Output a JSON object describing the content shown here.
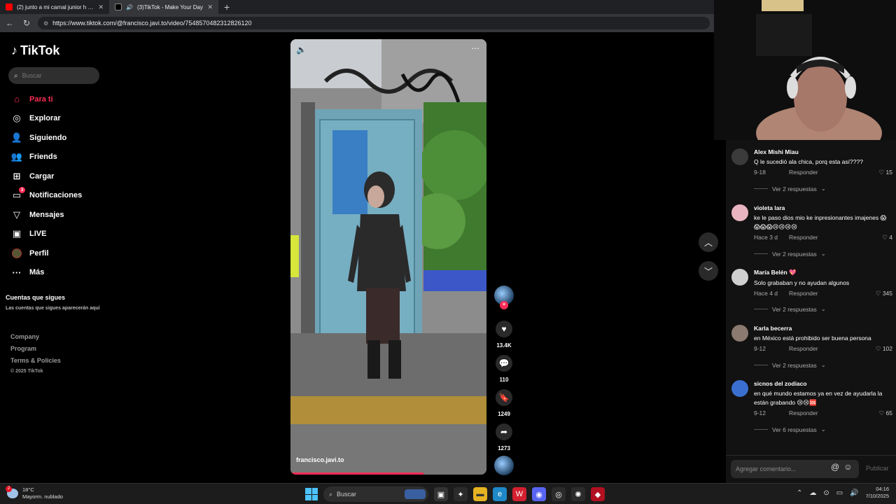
{
  "browser": {
    "tabs": [
      {
        "title": "(2) junto a mi carnal junior h (Let",
        "favicon": "youtube-icon",
        "active": false
      },
      {
        "title": "(3)TikTok - Make Your Day",
        "favicon": "tiktok-icon",
        "active": true
      }
    ],
    "url": "https://www.tiktok.com/@francisco.javi.to/video/7548570482312826120"
  },
  "sidebar": {
    "logo": "TikTok",
    "search_placeholder": "Buscar",
    "nav": [
      {
        "label": "Para ti",
        "icon": "home-icon",
        "active": true
      },
      {
        "label": "Explorar",
        "icon": "compass-icon"
      },
      {
        "label": "Siguiendo",
        "icon": "following-icon"
      },
      {
        "label": "Friends",
        "icon": "friends-icon"
      },
      {
        "label": "Cargar",
        "icon": "upload-icon"
      },
      {
        "label": "Notificaciones",
        "icon": "notifications-icon",
        "badge": "3"
      },
      {
        "label": "Mensajes",
        "icon": "messages-icon"
      },
      {
        "label": "LIVE",
        "icon": "live-icon"
      },
      {
        "label": "Perfil",
        "icon": "profile-avatar-icon"
      },
      {
        "label": "Más",
        "icon": "more-icon"
      }
    ],
    "following_title": "Cuentas que sigues",
    "following_placeholder": "Las cuentas que sigues aparecerán aquí",
    "footer": [
      "Company",
      "Program",
      "Terms & Policies"
    ],
    "copyright": "© 2025 TikTok"
  },
  "video": {
    "author": "francisco.javi.to",
    "progress": 0.68,
    "likes": "13.4K",
    "comments": "110",
    "saves": "1249",
    "shares": "1273"
  },
  "comments": [
    {
      "user": "Alex Mishi Miau",
      "text": "Q le sucedió ala chica, porq esta así????",
      "date": "9-18",
      "reply": "Responder",
      "likes": "15",
      "replies": "Ver 2 respuestas",
      "avatar_color": "#3b3b3b"
    },
    {
      "user": "violeta lara",
      "text": "ke le paso dios mio ke inpresionantes imajenes 😱😱😱😱😢😢😢😢",
      "date": "Hace 3 d",
      "reply": "Responder",
      "likes": "4",
      "replies": "Ver 2 respuestas",
      "avatar_color": "#e8b4c0"
    },
    {
      "user": "María Belén 💖",
      "text": "Solo grababan y no ayudan algunos",
      "date": "Hace 4 d",
      "reply": "Responder",
      "likes": "345",
      "replies": "Ver 2 respuestas",
      "avatar_color": "#cfcfcf"
    },
    {
      "user": "Karla becerra",
      "text": "en México está prohibido ser buena persona",
      "date": "9-12",
      "reply": "Responder",
      "likes": "102",
      "replies": "Ver 2 respuestas",
      "avatar_color": "#8a7a70"
    },
    {
      "user": "sicnos del zodiaco",
      "text": "en qué mundo estamos ya en vez de ayudarla la están grabando 😢😢🆘",
      "date": "9-12",
      "reply": "Responder",
      "likes": "65",
      "replies": "Ver 6 respuestas",
      "avatar_color": "#3a6fd0"
    }
  ],
  "comment_input": {
    "placeholder": "Agregar comentario...",
    "post": "Publicar"
  },
  "taskbar": {
    "weather_temp": "18°C",
    "weather_desc": "Mayorm. nublado",
    "weather_badge": "2",
    "search": "Buscar",
    "time": "04:16",
    "date": "7/10/2025"
  },
  "colors": {
    "accent": "#fe2c55",
    "background": "#000000",
    "panel": "#121212"
  }
}
